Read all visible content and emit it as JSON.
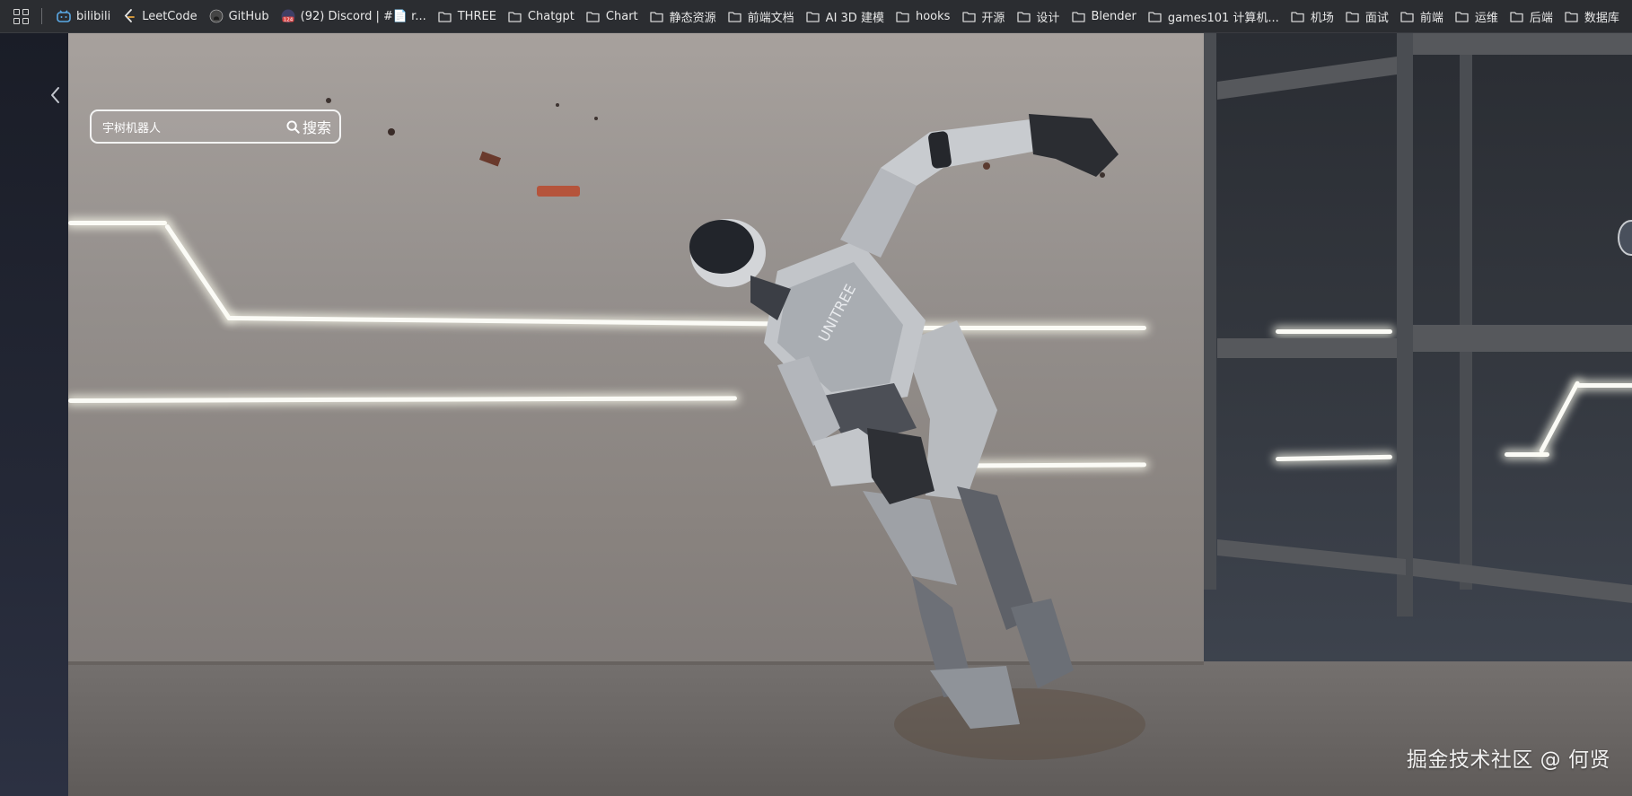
{
  "bookmarks": [
    {
      "label": "bilibili",
      "icon": "bilibili-icon",
      "color": "#5aa9e6"
    },
    {
      "label": "LeetCode",
      "icon": "leetcode-icon",
      "color": "#e6a23c"
    },
    {
      "label": "GitHub",
      "icon": "github-icon",
      "color": "#cfcfcf"
    },
    {
      "label": "(92) Discord | #📄 r...",
      "icon": "discord-icon",
      "color": "#7289da",
      "badge": "124"
    },
    {
      "label": "THREE",
      "icon": "folder-icon"
    },
    {
      "label": "Chatgpt",
      "icon": "folder-icon"
    },
    {
      "label": "Chart",
      "icon": "folder-icon"
    },
    {
      "label": "静态资源",
      "icon": "folder-icon"
    },
    {
      "label": "前端文档",
      "icon": "folder-icon"
    },
    {
      "label": "AI 3D 建模",
      "icon": "folder-icon"
    },
    {
      "label": "hooks",
      "icon": "folder-icon"
    },
    {
      "label": "开源",
      "icon": "folder-icon"
    },
    {
      "label": "设计",
      "icon": "folder-icon"
    },
    {
      "label": "Blender",
      "icon": "folder-icon"
    },
    {
      "label": "games101 计算机...",
      "icon": "folder-icon"
    },
    {
      "label": "机场",
      "icon": "folder-icon"
    },
    {
      "label": "面试",
      "icon": "folder-icon"
    },
    {
      "label": "前端",
      "icon": "folder-icon"
    },
    {
      "label": "运维",
      "icon": "folder-icon"
    },
    {
      "label": "后端",
      "icon": "folder-icon"
    },
    {
      "label": "数据库",
      "icon": "folder-icon"
    }
  ],
  "search": {
    "value": "宇树机器人",
    "button_label": "搜索"
  },
  "watermark": "掘金技术社区 @ 何贤",
  "colors": {
    "bookmark_bar": "#2b2d31",
    "led": "#fbfbf6",
    "wall": "#9a9591"
  }
}
